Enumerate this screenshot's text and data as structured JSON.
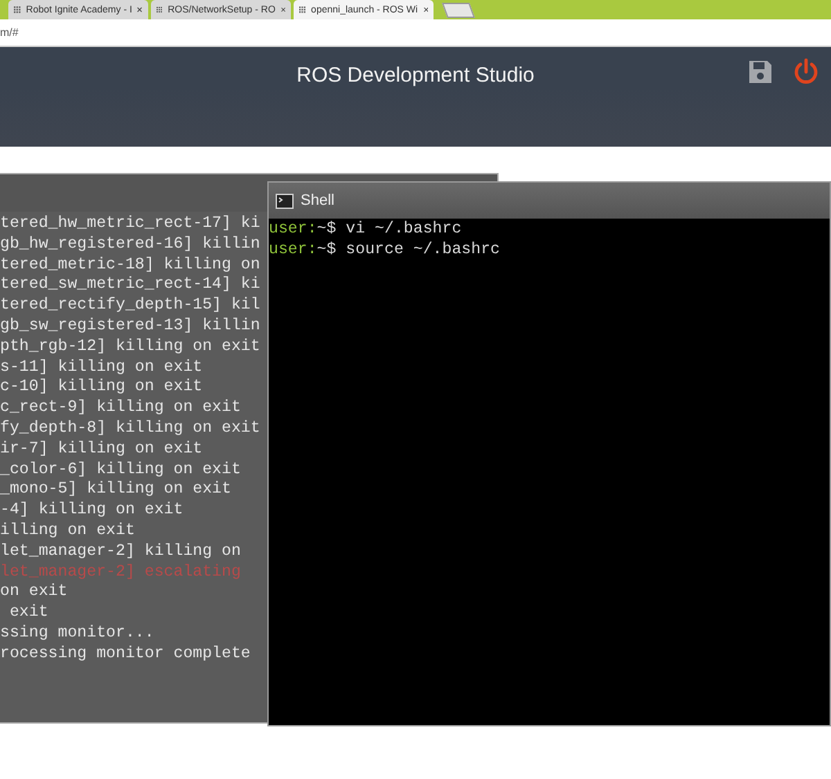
{
  "browser": {
    "tabs": [
      {
        "title": "Robot Ignite Academy - I",
        "selected": false
      },
      {
        "title": "ROS/NetworkSetup - RO",
        "selected": false
      },
      {
        "title": "openni_launch - ROS Wi",
        "selected": true
      }
    ],
    "address": "m/#"
  },
  "header": {
    "title": "ROS Development Studio"
  },
  "log_window": {
    "lines": [
      {
        "text": "tered_hw_metric_rect-17] ki",
        "kind": "info"
      },
      {
        "text": "gb_hw_registered-16] killin",
        "kind": "info"
      },
      {
        "text": "tered_metric-18] killing on",
        "kind": "info"
      },
      {
        "text": "tered_sw_metric_rect-14] ki",
        "kind": "info"
      },
      {
        "text": "tered_rectify_depth-15] kil",
        "kind": "info"
      },
      {
        "text": "gb_sw_registered-13] killin",
        "kind": "info"
      },
      {
        "text": "pth_rgb-12] killing on exit",
        "kind": "info"
      },
      {
        "text": "s-11] killing on exit",
        "kind": "info"
      },
      {
        "text": "c-10] killing on exit",
        "kind": "info"
      },
      {
        "text": "c_rect-9] killing on exit",
        "kind": "info"
      },
      {
        "text": "fy_depth-8] killing on exit",
        "kind": "info"
      },
      {
        "text": "ir-7] killing on exit",
        "kind": "info"
      },
      {
        "text": "_color-6] killing on exit",
        "kind": "info"
      },
      {
        "text": "_mono-5] killing on exit",
        "kind": "info"
      },
      {
        "text": "-4] killing on exit",
        "kind": "info"
      },
      {
        "text": "illing on exit",
        "kind": "info"
      },
      {
        "text": "let_manager-2] killing on",
        "kind": "info"
      },
      {
        "text": "let_manager-2] escalating",
        "kind": "error"
      },
      {
        "text": "on exit",
        "kind": "info"
      },
      {
        "text": " exit",
        "kind": "info"
      },
      {
        "text": "ssing monitor...",
        "kind": "info"
      },
      {
        "text": "rocessing monitor complete",
        "kind": "info"
      }
    ]
  },
  "shell": {
    "title": "Shell",
    "lines": [
      {
        "prompt": "user:",
        "command": "~$ vi ~/.bashrc"
      },
      {
        "prompt": "user:",
        "command": "~$ source ~/.bashrc"
      }
    ]
  }
}
